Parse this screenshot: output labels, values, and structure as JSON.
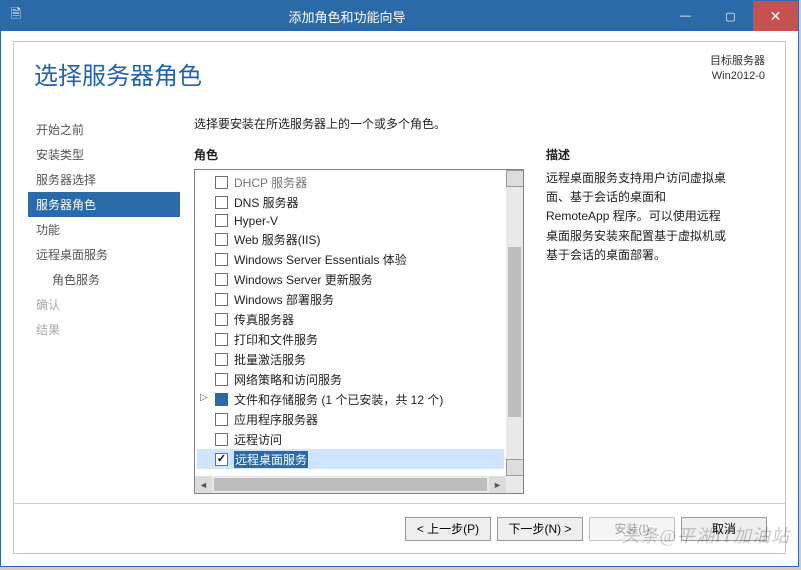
{
  "window": {
    "title": "添加角色和功能向导",
    "icon_glyph": "🗎"
  },
  "header": {
    "page_title": "选择服务器角色",
    "target_label": "目标服务器",
    "target_value": "Win2012-0"
  },
  "nav": {
    "items": [
      {
        "label": "开始之前",
        "state": "normal"
      },
      {
        "label": "安装类型",
        "state": "normal"
      },
      {
        "label": "服务器选择",
        "state": "normal"
      },
      {
        "label": "服务器角色",
        "state": "active"
      },
      {
        "label": "功能",
        "state": "normal"
      },
      {
        "label": "远程桌面服务",
        "state": "normal"
      },
      {
        "label": "角色服务",
        "state": "normal",
        "sub": true
      },
      {
        "label": "确认",
        "state": "disabled"
      },
      {
        "label": "结果",
        "state": "disabled"
      }
    ]
  },
  "main": {
    "instruction": "选择要安装在所选服务器上的一个或多个角色。",
    "roles_header": "角色",
    "desc_header": "描述",
    "desc_text": "远程桌面服务支持用户访问虚拟桌面、基于会话的桌面和 RemoteApp 程序。可以使用远程桌面服务安装来配置基于虚拟机或基于会话的桌面部署。",
    "roles": [
      {
        "label": "DHCP 服务器",
        "checked": false,
        "faded": true
      },
      {
        "label": "DNS 服务器",
        "checked": false
      },
      {
        "label": "Hyper-V",
        "checked": false
      },
      {
        "label": "Web 服务器(IIS)",
        "checked": false
      },
      {
        "label": "Windows Server Essentials 体验",
        "checked": false
      },
      {
        "label": "Windows Server 更新服务",
        "checked": false
      },
      {
        "label": "Windows 部署服务",
        "checked": false
      },
      {
        "label": "传真服务器",
        "checked": false
      },
      {
        "label": "打印和文件服务",
        "checked": false
      },
      {
        "label": "批量激活服务",
        "checked": false
      },
      {
        "label": "网络策略和访问服务",
        "checked": false
      },
      {
        "label": "文件和存储服务 (1 个已安装，共 12 个)",
        "checked": "partial",
        "expandable": true
      },
      {
        "label": "应用程序服务器",
        "checked": false
      },
      {
        "label": "远程访问",
        "checked": false
      },
      {
        "label": "远程桌面服务",
        "checked": true,
        "selected": true
      }
    ]
  },
  "footer": {
    "prev": "< 上一步(P)",
    "next": "下一步(N) >",
    "install": "安装(I)",
    "cancel": "取消"
  },
  "watermark": "头条@平湖IT加油站"
}
